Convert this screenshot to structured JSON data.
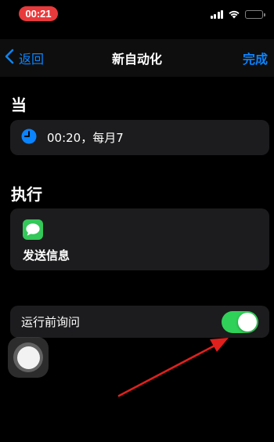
{
  "status_bar": {
    "time": "00:21",
    "icons": [
      "signal-icon",
      "wifi-icon",
      "battery-icon"
    ]
  },
  "nav": {
    "back_label": "返回",
    "title": "新自动化",
    "done_label": "完成"
  },
  "when_section": {
    "header": "当",
    "trigger_text": "00:20，每月7",
    "trigger_icon": "clock-icon"
  },
  "do_section": {
    "header": "执行",
    "action_icon": "messages-icon",
    "action_label": "发送信息"
  },
  "ask_before_running": {
    "label": "运行前询问",
    "enabled": true
  },
  "colors": {
    "accent": "#0a84ff",
    "toggle_on": "#30d158",
    "time_pill": "#e8393b",
    "card_bg": "#1c1c1e",
    "annotation_arrow": "#e0201c"
  }
}
